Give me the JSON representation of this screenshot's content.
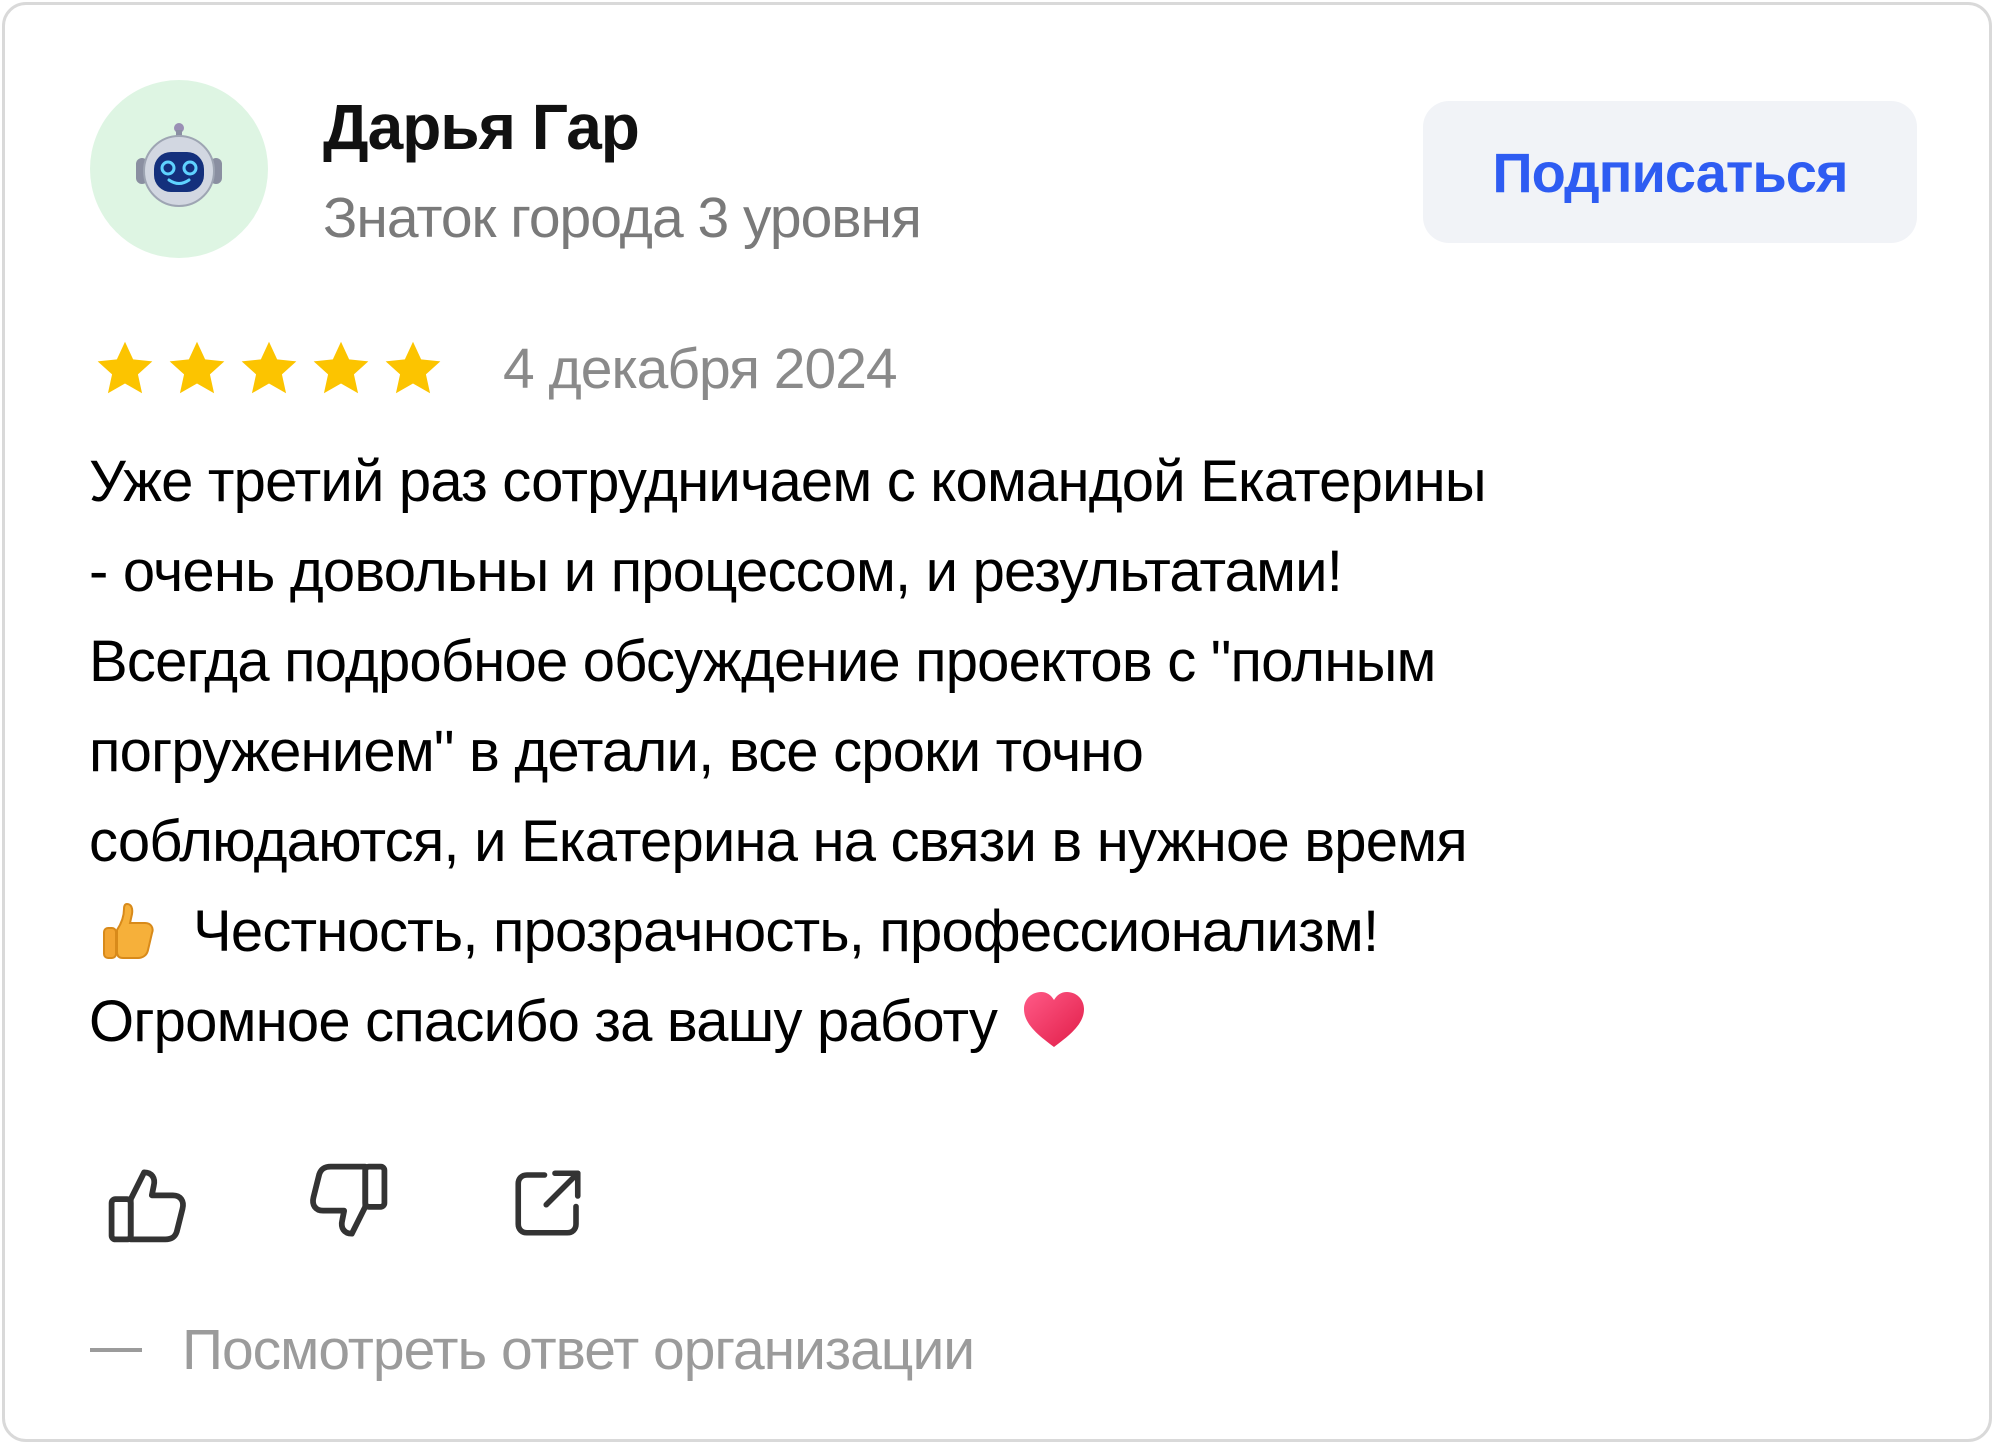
{
  "author": {
    "name": "Дарья Гар",
    "level": "Знаток города 3 уровня",
    "avatar_icon": "robot-icon",
    "avatar_bg": "#def5e3"
  },
  "subscribe_button": {
    "label": "Подписаться",
    "color": "#2e5cf2"
  },
  "review": {
    "rating": 5,
    "rating_max": 5,
    "star_color": "#fcc400",
    "date": "4 декабря 2024",
    "text_lines": [
      "Уже третий раз сотрудничаем с командой Екатерины",
      "- очень довольны и процессом, и результатами!",
      "Всегда подробное обсуждение проектов с \"полным",
      "погружением\" в детали, все сроки точно",
      "соблюдаются, и Екатерина на связи в нужное время",
      "Честность, прозрачность, профессионализм!",
      "Огромное спасибо за вашу работу"
    ],
    "emojis": [
      "thumbs-up-emoji",
      "heart-emoji"
    ]
  },
  "actions": {
    "like_icon": "thumbs-up-icon",
    "dislike_icon": "thumbs-down-icon",
    "share_icon": "share-icon"
  },
  "org_reply": {
    "label": "Посмотреть ответ организации"
  }
}
